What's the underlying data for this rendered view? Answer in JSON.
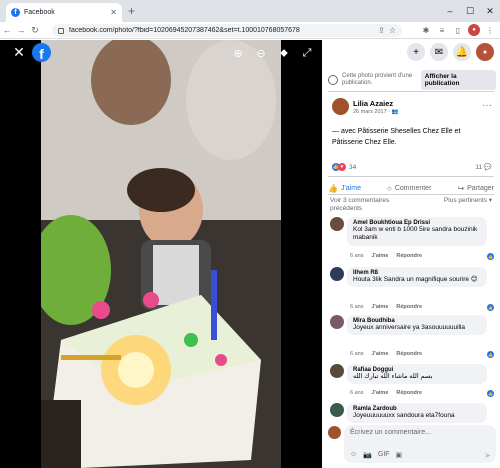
{
  "browser": {
    "tab_title": "Facebook",
    "tab_close": "✕",
    "new_tab": "+",
    "window_controls": [
      "–",
      "☐",
      "✕"
    ],
    "nav": [
      "←",
      "→",
      "↻"
    ],
    "url": "facebook.com/photo/?fbid=10206945207387462&set=t.100010768057678"
  },
  "viewer": {
    "close": "✕",
    "logo": "f",
    "tools": [
      "⊕",
      "⊖",
      "⬥",
      "⤢"
    ]
  },
  "topnav": {
    "plus": "+",
    "messenger": "✉",
    "bell": "🔔",
    "avatar": "●"
  },
  "notice": {
    "text": "Cette photo provient d'une publication.",
    "button": "Afficher la publication"
  },
  "post": {
    "author": "Lilia Azaiez",
    "date": "26 mars 2017 · 👥",
    "more": "···",
    "caption": "— avec Pâtisserie Sheselles Chez Elle et Pâtisserie Chez Elle.",
    "reaction_count": "34",
    "comment_count": "11 💬"
  },
  "actions": {
    "like": "J'aime",
    "comment": "Commenter",
    "share": "Partager"
  },
  "sort": {
    "previous": "Voir 3 commentaires précédents",
    "relevant": "Plus pertinents ▾"
  },
  "comments": [
    {
      "name": "Amel Boukhtioua Ep Drissi",
      "text": "Kol 3am w enti b 1000 5ire sandra bouzinik mabanik",
      "age": "6 ans",
      "like": "J'aime",
      "reply": "Répondre"
    },
    {
      "name": "Ilhem R8",
      "text": "Houta 3lik Sandra un magnifique sourire 😊",
      "age": "6 ans",
      "like": "J'aime",
      "reply": "Répondre"
    },
    {
      "name": "Mira Boudhiba",
      "text": "Joyeux anniversaire ya 3asouuuuuuilla",
      "age": "6 ans",
      "like": "J'aime",
      "reply": "Répondre"
    },
    {
      "name": "Rafiaa Doggui",
      "text": "بسم الله ماشاء الله تبارك الله",
      "age": "6 ans",
      "like": "J'aime",
      "reply": "Répondre"
    },
    {
      "name": "Ramla Zardoub",
      "text": "Joyeuuuuuuxx sandoura eta7founa"
    }
  ],
  "composer": {
    "placeholder": "Écrivez un commentaire...",
    "icons": [
      "☺",
      "📷",
      "GIF",
      "▣"
    ],
    "send": "➤"
  },
  "colors": {
    "accent": "#1877f2",
    "viewer_bg": "#000000",
    "bubble": "#f0f2f5"
  }
}
